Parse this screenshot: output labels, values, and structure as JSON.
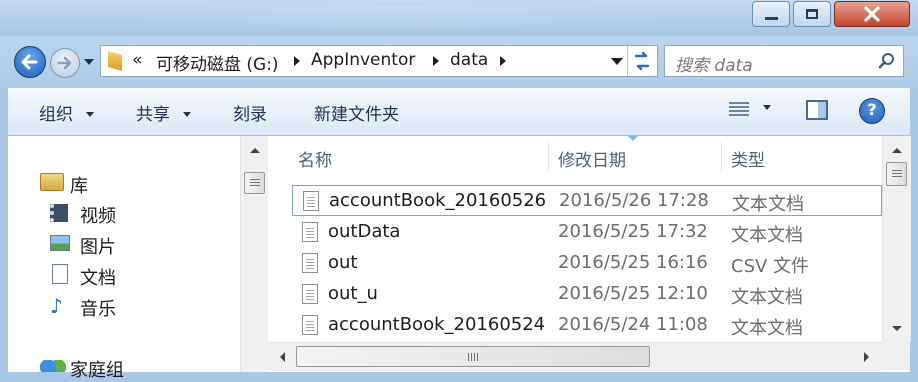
{
  "address": {
    "prefix": "«",
    "segments": [
      "可移动磁盘 (G:)",
      "AppInventor",
      "data"
    ]
  },
  "search": {
    "placeholder": "搜索 data"
  },
  "toolbar": {
    "organize": "组织",
    "share": "共享",
    "burn": "刻录",
    "new_folder": "新建文件夹"
  },
  "nav": {
    "library": "库",
    "items": [
      "视频",
      "图片",
      "文档",
      "音乐"
    ],
    "homegroup": "家庭组"
  },
  "columns": {
    "name": "名称",
    "modified": "修改日期",
    "type": "类型"
  },
  "files": [
    {
      "name": "accountBook_20160526",
      "modified": "2016/5/26 17:28",
      "type": "文本文档",
      "selected": true
    },
    {
      "name": "outData",
      "modified": "2016/5/25 17:32",
      "type": "文本文档"
    },
    {
      "name": "out",
      "modified": "2016/5/25 16:16",
      "type": "CSV 文件"
    },
    {
      "name": "out_u",
      "modified": "2016/5/25 12:10",
      "type": "文本文档"
    },
    {
      "name": "accountBook_20160524",
      "modified": "2016/5/24 11:08",
      "type": "文本文档"
    }
  ],
  "colors": {
    "accent": "#2a6ec0",
    "help": "#1f5fb8",
    "close": "#c2432c",
    "sort_arrow": "#7fb6e8"
  },
  "icons": [
    "back-arrow-icon",
    "forward-arrow-icon",
    "folder-icon",
    "refresh-icon",
    "search-icon",
    "view-options-icon",
    "preview-pane-icon",
    "help-icon",
    "library-icon",
    "video-icon",
    "picture-icon",
    "document-icon",
    "music-icon",
    "homegroup-icon",
    "text-file-icon"
  ]
}
